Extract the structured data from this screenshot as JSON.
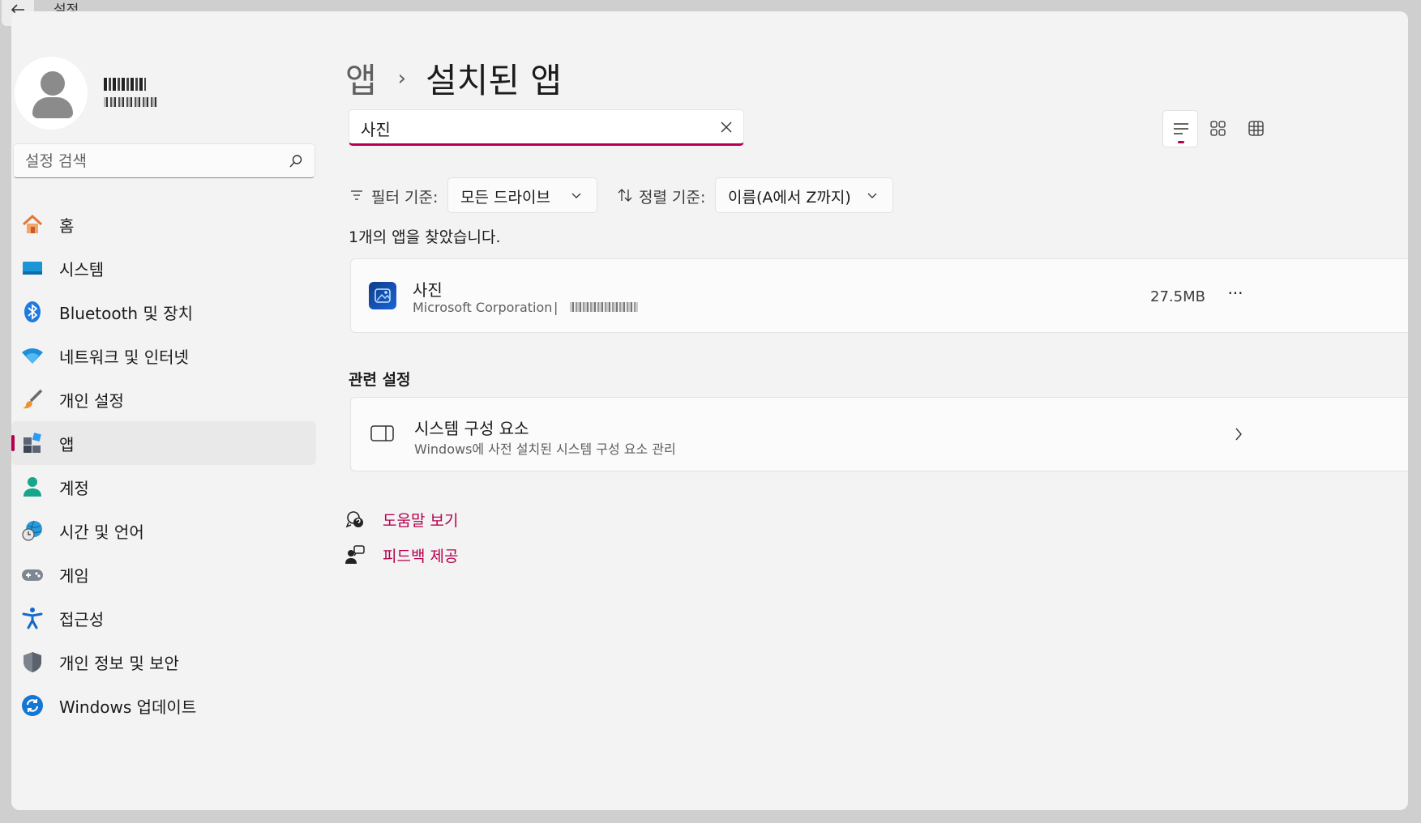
{
  "window": {
    "title": "설정"
  },
  "search": {
    "placeholder": "설정 검색"
  },
  "nav": {
    "items": [
      {
        "label": "홈",
        "icon": "home-icon"
      },
      {
        "label": "시스템",
        "icon": "system-icon"
      },
      {
        "label": "Bluetooth 및 장치",
        "icon": "bluetooth-icon"
      },
      {
        "label": "네트워크 및 인터넷",
        "icon": "wifi-icon"
      },
      {
        "label": "개인 설정",
        "icon": "brush-icon"
      },
      {
        "label": "앱",
        "icon": "apps-icon",
        "active": true
      },
      {
        "label": "계정",
        "icon": "account-icon"
      },
      {
        "label": "시간 및 언어",
        "icon": "globe-clock-icon"
      },
      {
        "label": "게임",
        "icon": "gamepad-icon"
      },
      {
        "label": "접근성",
        "icon": "accessibility-icon"
      },
      {
        "label": "개인 정보 및 보안",
        "icon": "shield-icon"
      },
      {
        "label": "Windows 업데이트",
        "icon": "update-icon"
      }
    ]
  },
  "breadcrumb": {
    "parent": "앱",
    "separator": "›",
    "current": "설치된 앱"
  },
  "app_search": {
    "value": "사진"
  },
  "filter": {
    "filter_label": "필터 기준:",
    "filter_value": "모든 드라이브",
    "sort_label": "정렬 기준:",
    "sort_value": "이름(A에서 Z까지)"
  },
  "results": {
    "count_text": "1개의 앱을 찾았습니다."
  },
  "app": {
    "name": "사진",
    "publisher": "Microsoft Corporation",
    "separator": "|",
    "size": "27.5MB",
    "more": "···"
  },
  "related": {
    "title": "관련 설정",
    "item_title": "시스템 구성 요소",
    "item_subtitle": "Windows에 사전 설치된 시스템 구성 요소 관리"
  },
  "links": {
    "help": "도움말 보기",
    "feedback": "피드백 제공"
  },
  "colors": {
    "accent": "#b4004e",
    "background": "#f3f3f3",
    "card": "#fbfbfb"
  }
}
